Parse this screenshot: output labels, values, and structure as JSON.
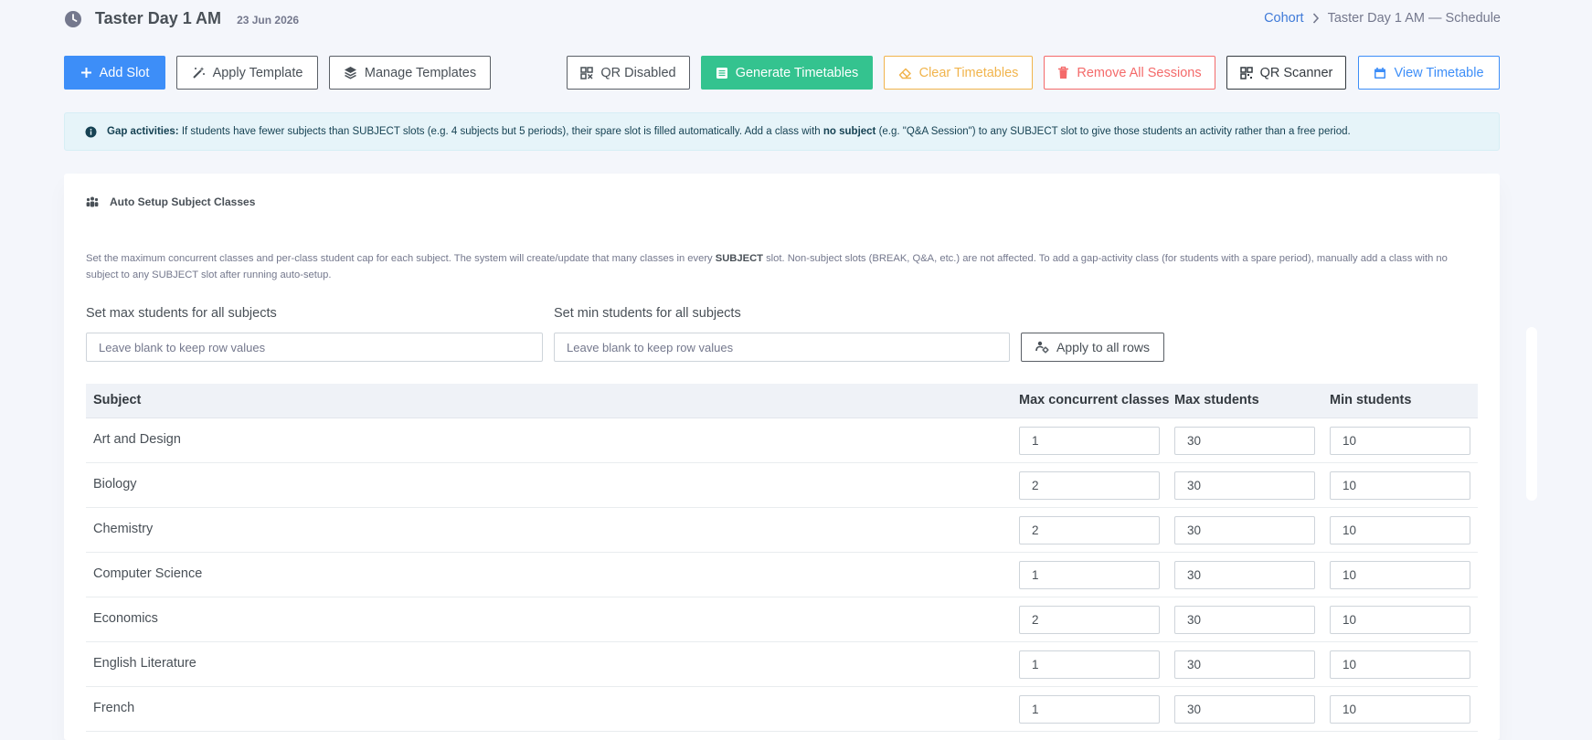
{
  "header": {
    "title": "Taster Day 1 AM",
    "date": "23 Jun 2026",
    "breadcrumb": {
      "link": "Cohort",
      "current": "Taster Day 1 AM — Schedule"
    }
  },
  "toolbar": {
    "add_slot": "Add Slot",
    "apply_template": "Apply Template",
    "manage_templates": "Manage Templates",
    "qr_disabled": "QR Disabled",
    "generate_timetables": "Generate Timetables",
    "clear_timetables": "Clear Timetables",
    "remove_all_sessions": "Remove All Sessions",
    "qr_scanner": "QR Scanner",
    "view_timetable": "View Timetable"
  },
  "alert": {
    "bold_lead": "Gap activities:",
    "text1": " If students have fewer subjects than SUBJECT slots (e.g. 4 subjects but 5 periods), their spare slot is filled automatically. Add a class with ",
    "bold_mid": "no subject",
    "text2": " (e.g. \"Q&A Session\") to any SUBJECT slot to give those students an activity rather than a free period."
  },
  "card": {
    "title": "Auto Setup Subject Classes",
    "desc1": "Set the maximum concurrent classes and per-class student cap for each subject. The system will create/update that many classes in every ",
    "desc_bold": "SUBJECT",
    "desc2": " slot. Non-subject slots (BREAK, Q&A, etc.) are not affected. To add a gap-activity class (for students with a spare period), manually add a class with no subject to any SUBJECT slot after running auto-setup.",
    "max_label": "Set max students for all subjects",
    "min_label": "Set min students for all subjects",
    "placeholder": "Leave blank to keep row values",
    "apply_all": "Apply to all rows"
  },
  "table": {
    "headers": {
      "subject": "Subject",
      "max_concurrent": "Max concurrent classes",
      "max_students": "Max students",
      "min_students": "Min students"
    },
    "rows": [
      {
        "subject": "Art and Design",
        "max_concurrent": "1",
        "max_students": "30",
        "min_students": "10"
      },
      {
        "subject": "Biology",
        "max_concurrent": "2",
        "max_students": "30",
        "min_students": "10"
      },
      {
        "subject": "Chemistry",
        "max_concurrent": "2",
        "max_students": "30",
        "min_students": "10"
      },
      {
        "subject": "Computer Science",
        "max_concurrent": "1",
        "max_students": "30",
        "min_students": "10"
      },
      {
        "subject": "Economics",
        "max_concurrent": "2",
        "max_students": "30",
        "min_students": "10"
      },
      {
        "subject": "English Literature",
        "max_concurrent": "1",
        "max_students": "30",
        "min_students": "10"
      },
      {
        "subject": "French",
        "max_concurrent": "1",
        "max_students": "30",
        "min_students": "10"
      }
    ]
  },
  "colors": {
    "primary": "#3d8ef8",
    "success": "#34c38f",
    "warning": "#f1b44c",
    "danger": "#f46a6a",
    "info_bg": "#e6f4f9"
  }
}
